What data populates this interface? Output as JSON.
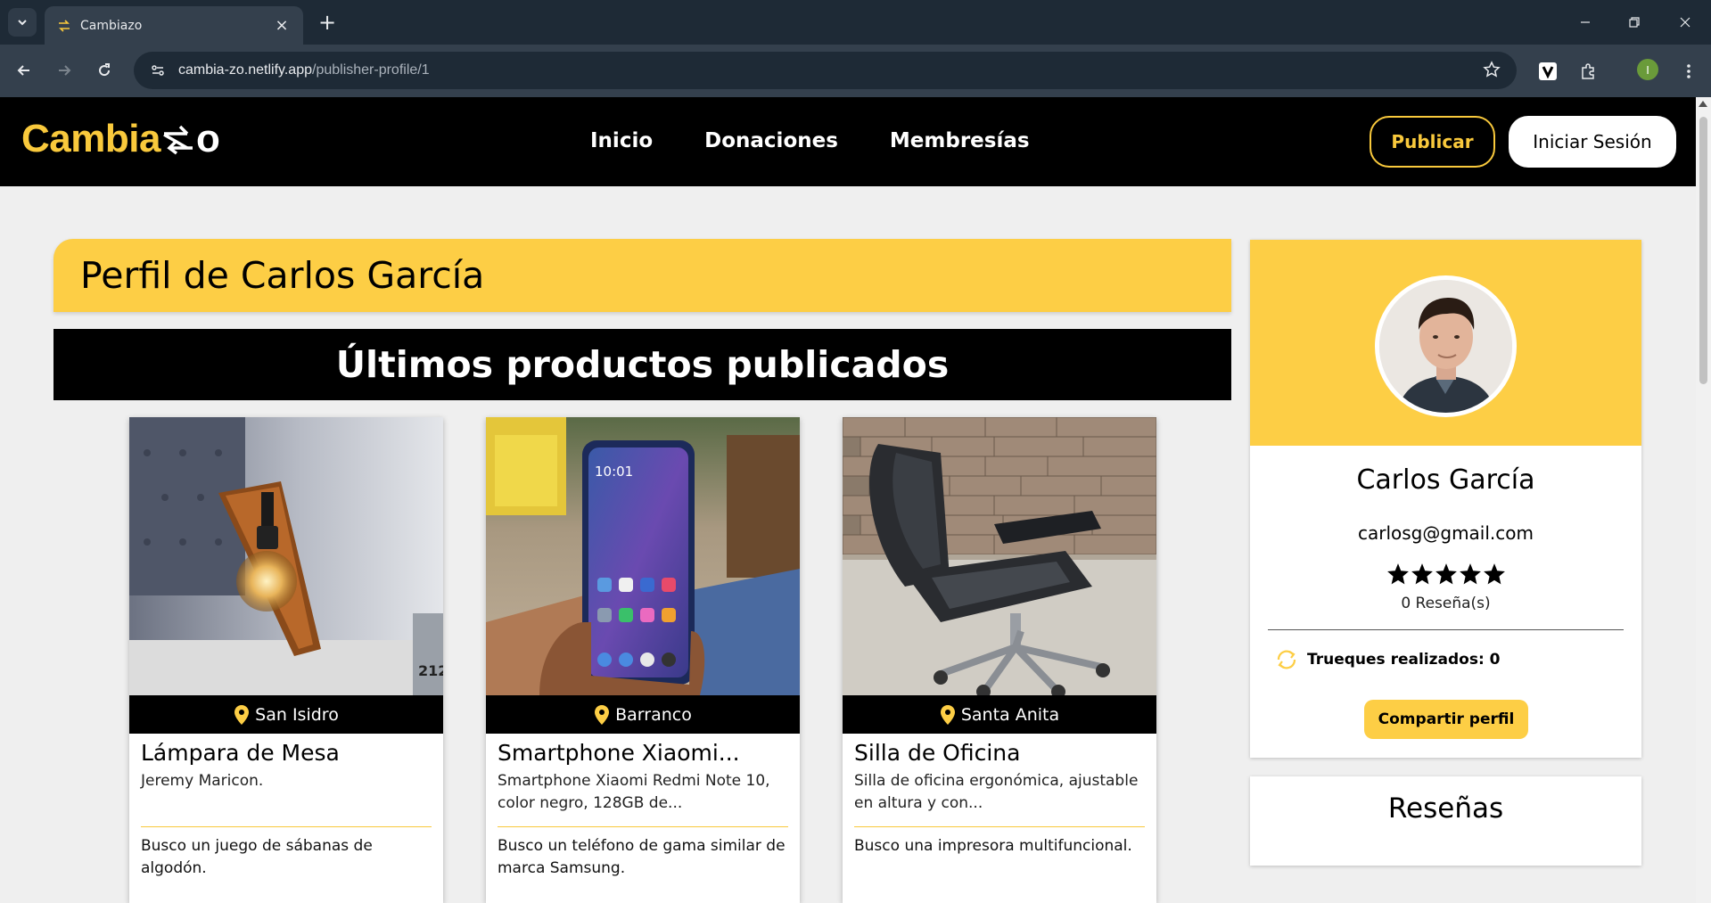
{
  "browser": {
    "tab_title": "Cambiazo",
    "url_host": "cambia-zo.netlify.app",
    "url_path": "/publisher-profile/1",
    "profile_initial": "I"
  },
  "site": {
    "logo_main": "Cambia",
    "logo_end": "o",
    "nav": [
      "Inicio",
      "Donaciones",
      "Membresías"
    ],
    "publish_label": "Publicar",
    "login_label": "Iniciar Sesión",
    "accent_color": "#fdce45"
  },
  "page": {
    "profile_title": "Perfil de Carlos García",
    "section_title": "Últimos productos publicados"
  },
  "products": [
    {
      "location": "San Isidro",
      "name": "Lámpara de Mesa",
      "description": "Jeremy Maricon.",
      "wants": "Busco un juego de sábanas de algodón."
    },
    {
      "location": "Barranco",
      "name": "Smartphone Xiaomi...",
      "description": "Smartphone Xiaomi Redmi Note 10, color negro, 128GB de...",
      "wants": "Busco un teléfono de gama similar de marca Samsung."
    },
    {
      "location": "Santa Anita",
      "name": "Silla de Oficina",
      "description": "Silla de oficina ergonómica, ajustable en altura y con...",
      "wants": "Busco una impresora multifuncional."
    }
  ],
  "profile": {
    "name": "Carlos García",
    "email": "carlosg@gmail.com",
    "rating_stars": 5,
    "reviews_count": "0 Reseña(s)",
    "trades": "Trueques realizados: 0",
    "share_label": "Compartir perfil",
    "reviews_title": "Reseñas"
  }
}
